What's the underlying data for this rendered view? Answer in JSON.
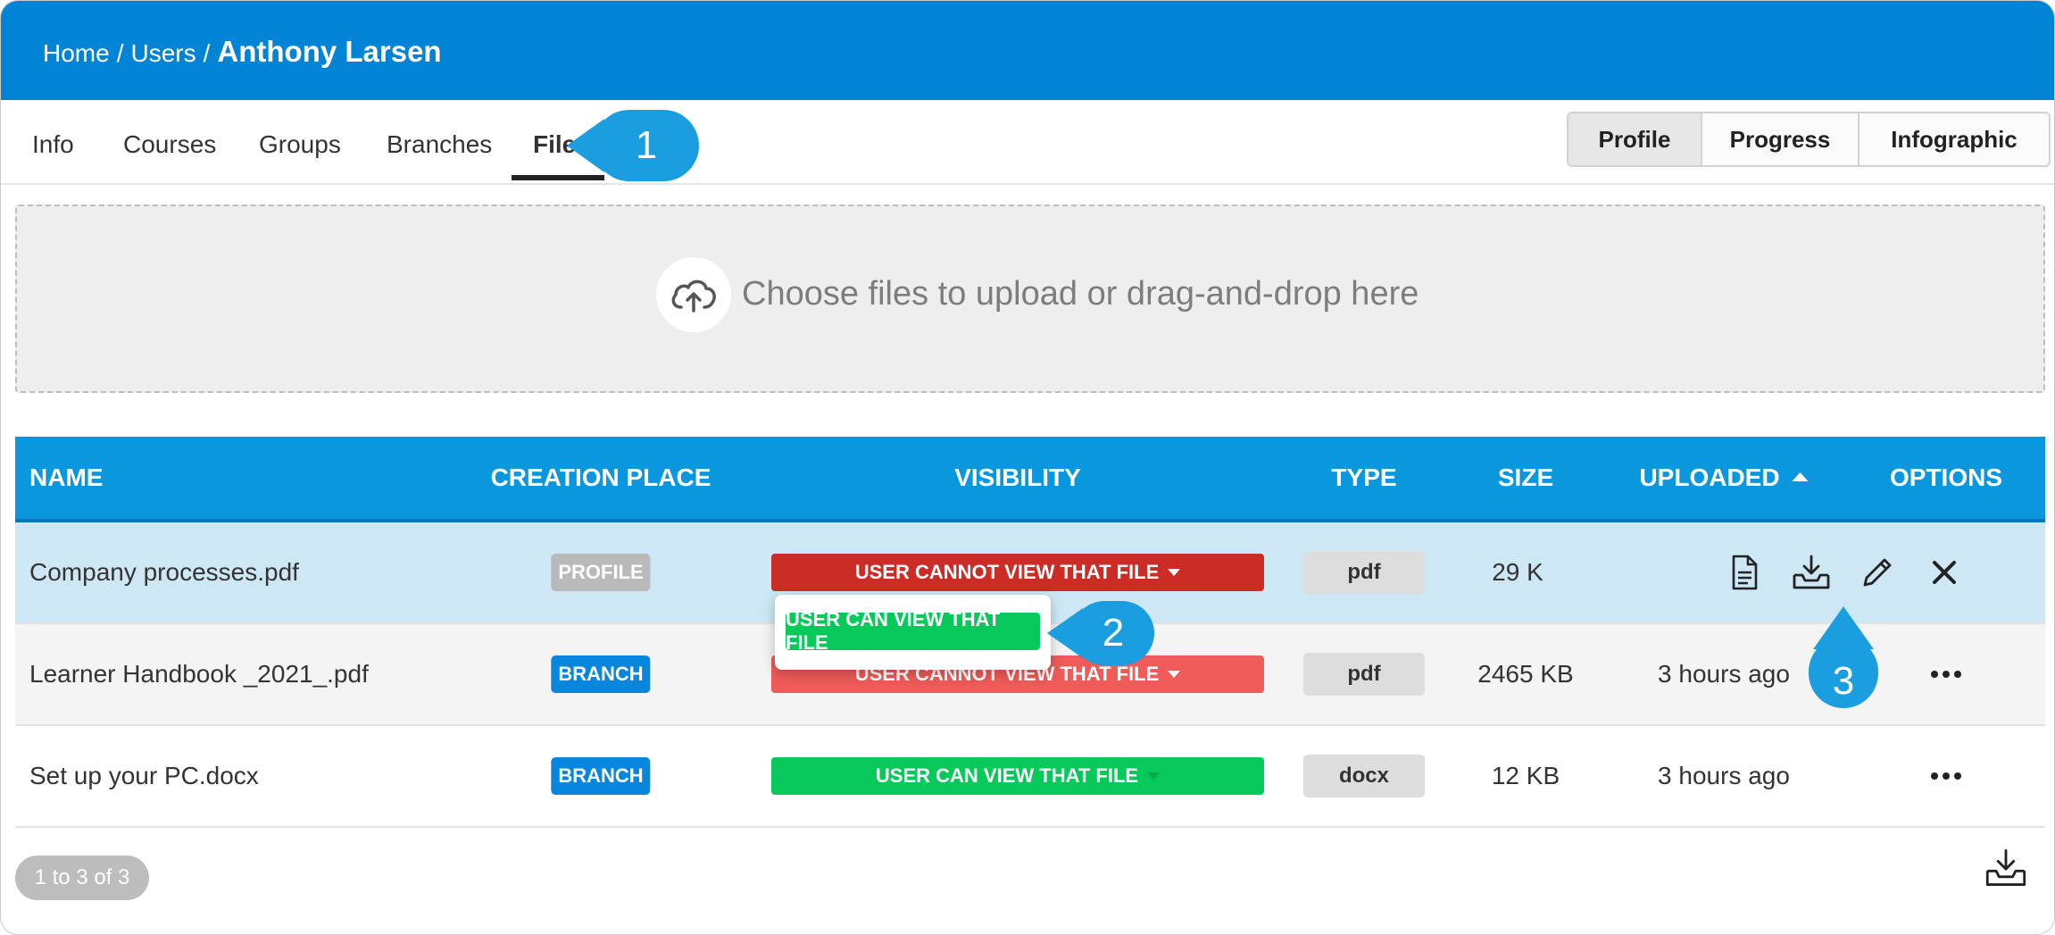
{
  "breadcrumb": {
    "home": "Home",
    "sep": "/",
    "users": "Users",
    "current": "Anthony Larsen"
  },
  "tabs": [
    "Info",
    "Courses",
    "Groups",
    "Branches",
    "Files"
  ],
  "active_tab": "Files",
  "view_toggle": [
    "Profile",
    "Progress",
    "Infographic"
  ],
  "active_view": "Profile",
  "upload": {
    "text": "Choose files to upload or drag-and-drop here",
    "icon": "cloud-upload-icon"
  },
  "table": {
    "headers": {
      "name": "NAME",
      "creation_place": "CREATION PLACE",
      "visibility": "VISIBILITY",
      "type": "TYPE",
      "size": "SIZE",
      "uploaded": "UPLOADED",
      "options": "OPTIONS"
    },
    "sort_column": "UPLOADED",
    "rows": [
      {
        "name": "Company processes.pdf",
        "creation_place": "PROFILE",
        "visibility": "USER CANNOT VIEW THAT FILE",
        "type": "pdf",
        "size": "29 K",
        "uploaded": ""
      },
      {
        "name": "Learner Handbook _2021_.pdf",
        "creation_place": "BRANCH",
        "visibility": "USER CANNOT VIEW THAT FILE",
        "type": "pdf",
        "size": "2465 KB",
        "uploaded": "3 hours ago"
      },
      {
        "name": "Set up your PC.docx",
        "creation_place": "BRANCH",
        "visibility": "USER CAN VIEW THAT FILE",
        "type": "docx",
        "size": "12 KB",
        "uploaded": "3 hours ago"
      }
    ]
  },
  "dropdown": {
    "option": "USER CAN VIEW THAT FILE"
  },
  "callouts": [
    "1",
    "2",
    "3"
  ],
  "pager": "1 to 3 of 3",
  "colors": {
    "header": "#0284d6",
    "table_header": "#0a97de",
    "red": "#cc2c26",
    "green": "#06c95a",
    "callout": "#1a9ee0"
  }
}
